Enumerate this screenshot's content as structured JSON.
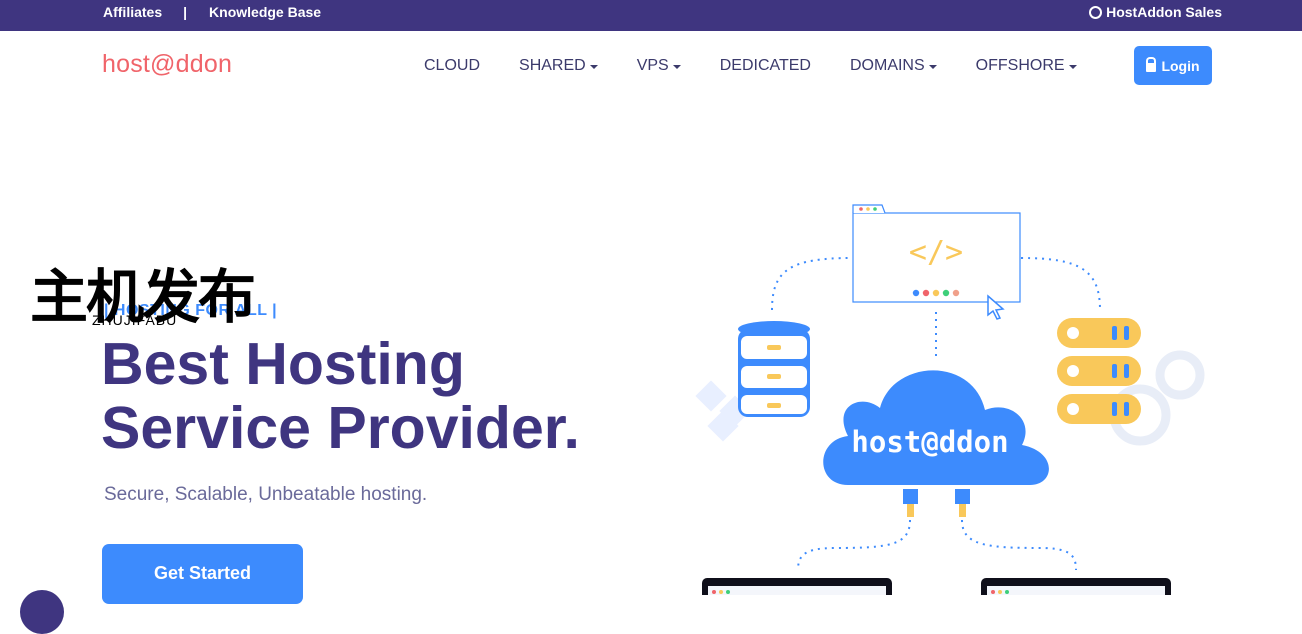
{
  "topbar": {
    "affiliates": "Affiliates",
    "separator": "|",
    "knowledge_base": "Knowledge Base",
    "sales": "HostAddon Sales"
  },
  "nav": {
    "logo": "host@ddon",
    "items": [
      "CLOUD",
      "SHARED",
      "VPS",
      "DEDICATED",
      "DOMAINS",
      "OFFSHORE"
    ],
    "login": "Login"
  },
  "hero": {
    "tagline": "| HOSTING FOR ALL |",
    "title_line1": "Best Hosting",
    "title_line2": "Service Provider.",
    "subtitle": "Secure, Scalable, Unbeatable hosting.",
    "cta": "Get Started"
  },
  "illustration": {
    "cloud_label": "host@ddon",
    "code_glyph": "</>"
  },
  "watermark": {
    "chinese": "主机发布",
    "latin": "ZHUJIFABU"
  },
  "colors": {
    "topbar": "#3f3580",
    "primary": "#3d8bfd",
    "logo": "#f0646a",
    "heading": "#3f3580",
    "accent_yellow": "#f9c85a"
  }
}
